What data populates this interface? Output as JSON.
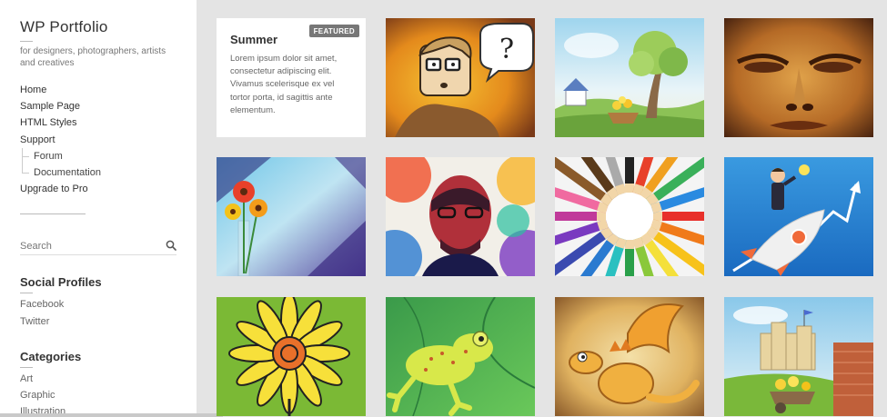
{
  "site": {
    "title": "WP Portfolio",
    "tagline": "for designers, photographers, artists and creatives"
  },
  "nav": {
    "items": [
      {
        "label": "Home",
        "sub": false
      },
      {
        "label": "Sample Page",
        "sub": false
      },
      {
        "label": "HTML Styles",
        "sub": false
      },
      {
        "label": "Support",
        "sub": false
      },
      {
        "label": "Forum",
        "sub": true
      },
      {
        "label": "Documentation",
        "sub": true
      },
      {
        "label": "Upgrade to Pro",
        "sub": false
      }
    ]
  },
  "search": {
    "placeholder": "Search",
    "icon": "search-icon"
  },
  "social": {
    "title": "Social Profiles",
    "links": [
      "Facebook",
      "Twitter"
    ]
  },
  "categories": {
    "title": "Categories",
    "links": [
      "Art",
      "Graphic",
      "Illustration"
    ]
  },
  "featured": {
    "title": "Summer",
    "badge": "FEATURED",
    "text": "Lorem ipsum dolor sit amet, consectetur adipiscing elit. Vivamus scelerisque ex vel tortor porta, id sagittis ante elementum."
  },
  "portfolio": {
    "thumbnails": [
      "cartoon-man-question-thumbnail",
      "house-tree-landscape-thumbnail",
      "golden-face-closeup-thumbnail",
      "flowers-abstract-blue-thumbnail",
      "colorful-portrait-thumbnail",
      "colored-pencils-circle-thumbnail",
      "businessman-rocket-thumbnail",
      "yellow-flower-drawing-thumbnail",
      "green-frog-thumbnail",
      "cartoon-dragon-thumbnail",
      "castle-wheelbarrow-thumbnail"
    ]
  },
  "colors": {
    "background": "#e4e4e4",
    "sidebar": "#ffffff",
    "badge": "#777777",
    "text": "#333333"
  }
}
